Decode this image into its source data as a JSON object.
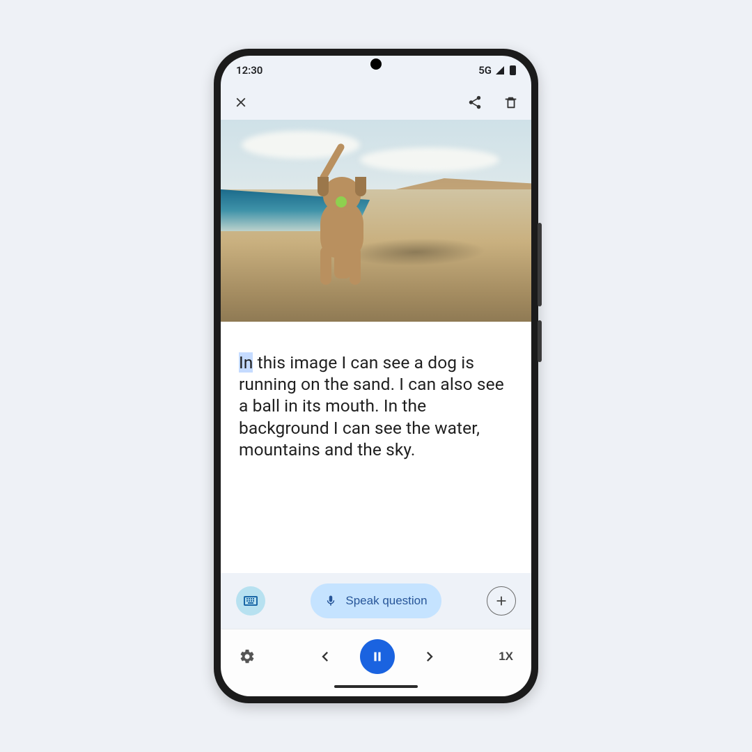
{
  "statusbar": {
    "time": "12:30",
    "network": "5G"
  },
  "caption": {
    "highlighted_word": "In",
    "rest": " this image I can see a dog is running on the sand. I can also see a ball in its mouth. In the background I can see the water, mountains and the sky."
  },
  "ask": {
    "label": "Speak question"
  },
  "playback": {
    "speed": "1X"
  }
}
